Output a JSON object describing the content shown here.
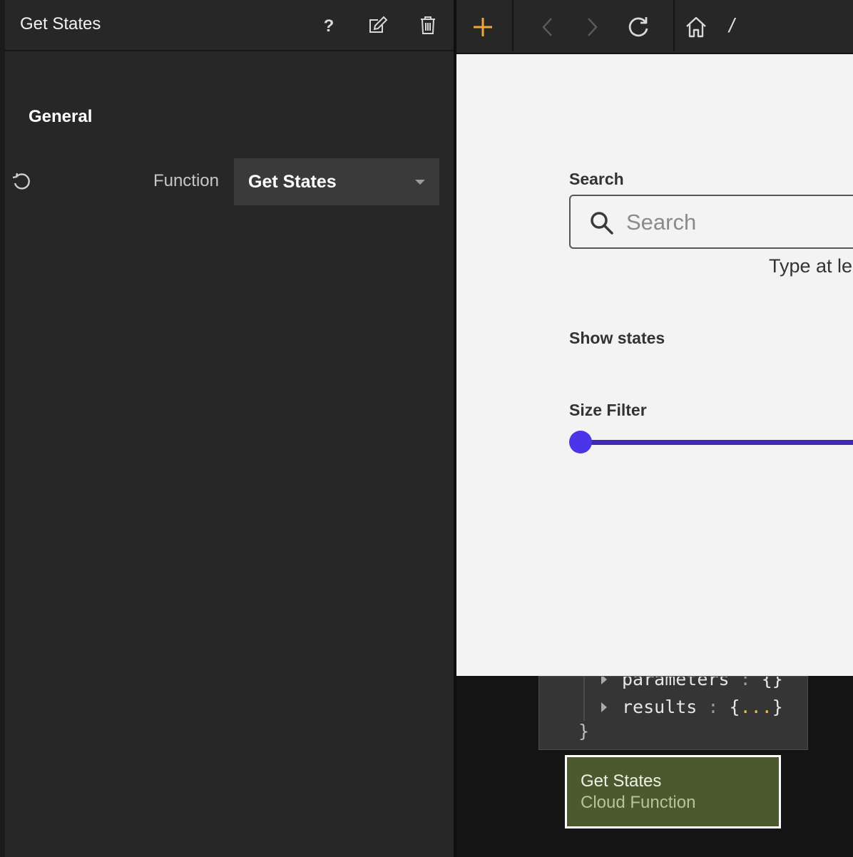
{
  "panel": {
    "title": "Get States",
    "section": "General",
    "function_label": "Function",
    "function_value": "Get States"
  },
  "toolbar": {
    "path": "/"
  },
  "preview": {
    "search_label": "Search",
    "search_placeholder": "Search",
    "helper_text": "Type at le",
    "show_states_label": "Show states",
    "size_filter_label": "Size Filter",
    "slider_value": 0
  },
  "debug": {
    "parameters_key": "parameters",
    "parameters_value": "{}",
    "results_key": "results",
    "results_open": "{",
    "results_dots": "...",
    "results_close": "}",
    "colon": ":",
    "closing_brace": "}"
  },
  "node": {
    "title": "Get States",
    "subtitle": "Cloud Function"
  },
  "colors": {
    "accent": "#e8a93a",
    "slider": "#4a35e8",
    "node_bg": "#4b5a2e"
  }
}
